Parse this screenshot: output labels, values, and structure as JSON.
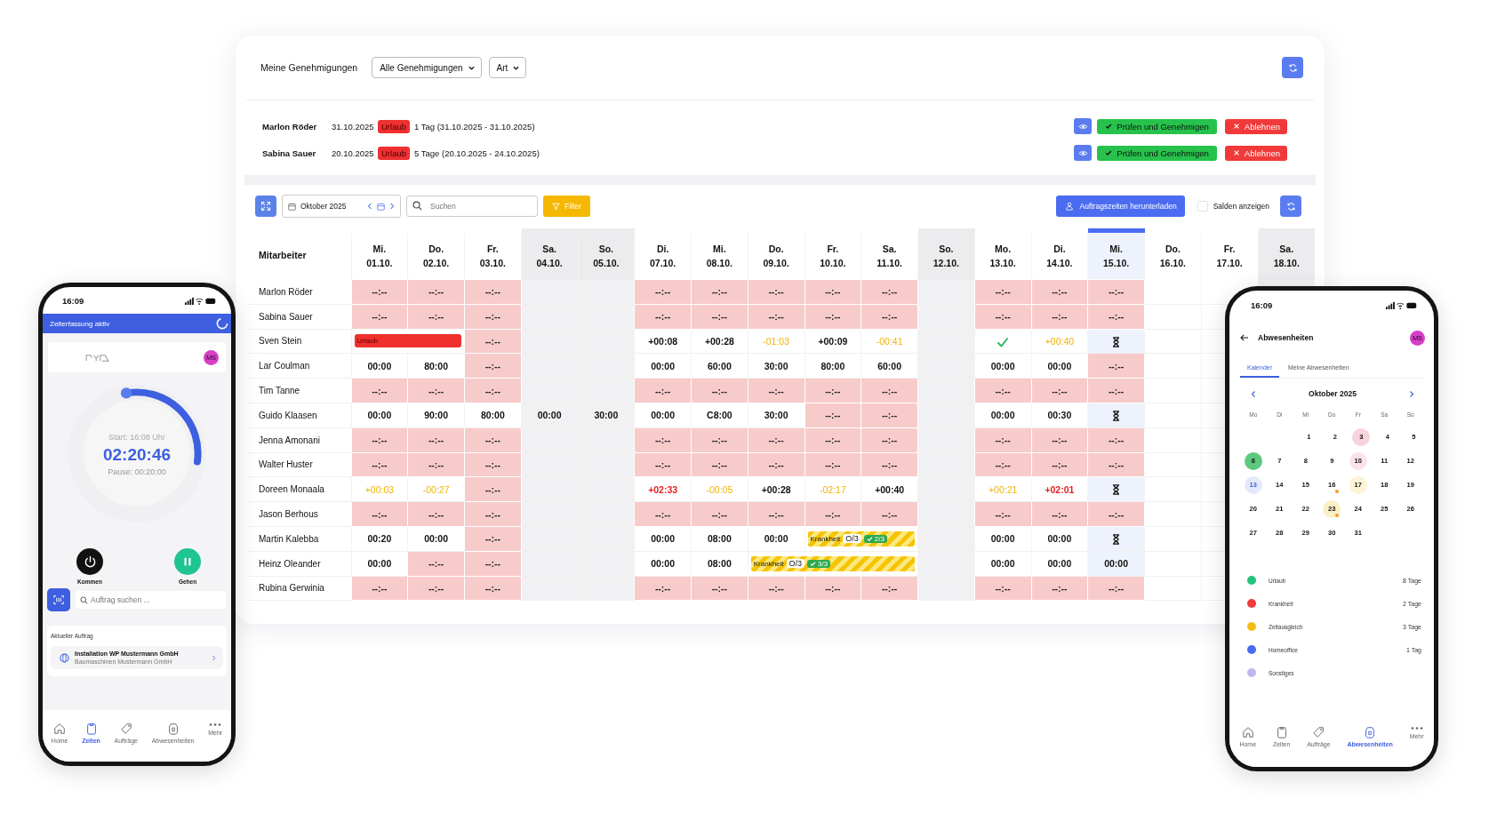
{
  "approvals": {
    "title": "Meine Genehmigungen",
    "filter": "Alle Genehmigungen",
    "type_filter": "Art",
    "requests": [
      {
        "name": "Marlon Röder",
        "date": "31.10.2025",
        "badge": "Urlaub",
        "details": "1 Tag (31.10.2025 - 31.10.2025)",
        "approve": "Prüfen und Genehmigen",
        "reject": "Ablehnen"
      },
      {
        "name": "Sabina Sauer",
        "date": "20.10.2025",
        "badge": "Urlaub",
        "details": "5 Tage (20.10.2025 - 24.10.2025)",
        "approve": "Prüfen und Genehmigen",
        "reject": "Ablehnen"
      }
    ]
  },
  "toolbar": {
    "month": "Oktober 2025",
    "search_placeholder": "Suchen",
    "filter": "Filter",
    "download": "Auftragszeiten herunterladen",
    "balances_label": "Salden anzeigen",
    "balances_checked": false
  },
  "table": {
    "name_header": "Mitarbeiter",
    "columns": [
      {
        "weekday": "Mi.",
        "date": "01.10.",
        "weekend": false,
        "selected": false
      },
      {
        "weekday": "Do.",
        "date": "02.10.",
        "weekend": false,
        "selected": false
      },
      {
        "weekday": "Fr.",
        "date": "03.10.",
        "weekend": false,
        "selected": false
      },
      {
        "weekday": "Sa.",
        "date": "04.10.",
        "weekend": true,
        "selected": false
      },
      {
        "weekday": "So.",
        "date": "05.10.",
        "weekend": true,
        "selected": false
      },
      {
        "weekday": "Di.",
        "date": "07.10.",
        "weekend": false,
        "selected": false
      },
      {
        "weekday": "Mi.",
        "date": "08.10.",
        "weekend": false,
        "selected": false
      },
      {
        "weekday": "Do.",
        "date": "09.10.",
        "weekend": false,
        "selected": false
      },
      {
        "weekday": "Fr.",
        "date": "10.10.",
        "weekend": false,
        "selected": false
      },
      {
        "weekday": "Sa.",
        "date": "11.10.",
        "weekend": false,
        "selected": false
      },
      {
        "weekday": "So.",
        "date": "12.10.",
        "weekend": true,
        "selected": false
      },
      {
        "weekday": "Mo.",
        "date": "13.10.",
        "weekend": false,
        "selected": false
      },
      {
        "weekday": "Di.",
        "date": "14.10.",
        "weekend": false,
        "selected": false
      },
      {
        "weekday": "Mi.",
        "date": "15.10.",
        "weekend": false,
        "selected": true
      },
      {
        "weekday": "Do.",
        "date": "16.10.",
        "weekend": false,
        "selected": false
      },
      {
        "weekday": "Fr.",
        "date": "17.10.",
        "weekend": false,
        "selected": false
      },
      {
        "weekday": "Sa.",
        "date": "18.10.",
        "weekend": true,
        "selected": false
      }
    ],
    "rows": [
      {
        "name": "Marlon Röder",
        "cells": [
          {
            "kind": "missing",
            "text": "--:--"
          },
          {
            "kind": "missing",
            "text": "--:--"
          },
          {
            "kind": "missing",
            "text": "--:--"
          },
          {
            "kind": "empty"
          },
          {
            "kind": "empty"
          },
          {
            "kind": "missing",
            "text": "--:--"
          },
          {
            "kind": "missing",
            "text": "--:--"
          },
          {
            "kind": "missing",
            "text": "--:--"
          },
          {
            "kind": "missing",
            "text": "--:--"
          },
          {
            "kind": "missing",
            "text": "--:--"
          },
          {
            "kind": "empty"
          },
          {
            "kind": "missing",
            "text": "--:--"
          },
          {
            "kind": "missing",
            "text": "--:--"
          },
          {
            "kind": "missing",
            "text": "--:--"
          },
          {
            "kind": "empty"
          },
          {
            "kind": "empty"
          },
          {
            "kind": "empty"
          }
        ]
      },
      {
        "name": "Sabina Sauer",
        "cells": [
          {
            "kind": "missing",
            "text": "--:--"
          },
          {
            "kind": "missing",
            "text": "--:--"
          },
          {
            "kind": "missing",
            "text": "--:--"
          },
          {
            "kind": "empty"
          },
          {
            "kind": "empty"
          },
          {
            "kind": "missing",
            "text": "--:--"
          },
          {
            "kind": "missing",
            "text": "--:--"
          },
          {
            "kind": "missing",
            "text": "--:--"
          },
          {
            "kind": "missing",
            "text": "--:--"
          },
          {
            "kind": "missing",
            "text": "--:--"
          },
          {
            "kind": "empty"
          },
          {
            "kind": "missing",
            "text": "--:--"
          },
          {
            "kind": "missing",
            "text": "--:--"
          },
          {
            "kind": "missing",
            "text": "--:--"
          },
          {
            "kind": "empty"
          },
          {
            "kind": "empty"
          },
          {
            "kind": "empty"
          }
        ]
      },
      {
        "name": "Sven Stein",
        "cells": [
          {
            "kind": "absence",
            "text": "Urlaub",
            "colspan": 2
          },
          {
            "kind": "missing",
            "text": "--:--"
          },
          {
            "kind": "empty"
          },
          {
            "kind": "empty"
          },
          {
            "kind": "value",
            "text": "+00:08"
          },
          {
            "kind": "value",
            "text": "+00:28"
          },
          {
            "kind": "warn",
            "text": "-01:03"
          },
          {
            "kind": "value",
            "text": "+00:09"
          },
          {
            "kind": "warn",
            "text": "-00:41"
          },
          {
            "kind": "empty"
          },
          {
            "kind": "check"
          },
          {
            "kind": "warn",
            "text": "+00:40"
          },
          {
            "kind": "pending"
          },
          {
            "kind": "empty"
          },
          {
            "kind": "empty"
          },
          {
            "kind": "empty"
          }
        ]
      },
      {
        "name": "Lar Coulman",
        "cells": [
          {
            "kind": "value",
            "text": "00:00"
          },
          {
            "kind": "value",
            "text": "80:00"
          },
          {
            "kind": "missing",
            "text": "--:--"
          },
          {
            "kind": "empty"
          },
          {
            "kind": "empty"
          },
          {
            "kind": "value",
            "text": "00:00"
          },
          {
            "kind": "value",
            "text": "60:00"
          },
          {
            "kind": "value",
            "text": "30:00"
          },
          {
            "kind": "value",
            "text": "80:00"
          },
          {
            "kind": "value",
            "text": "60:00"
          },
          {
            "kind": "empty"
          },
          {
            "kind": "value",
            "text": "00:00"
          },
          {
            "kind": "value",
            "text": "00:00"
          },
          {
            "kind": "missing",
            "text": "--:--"
          },
          {
            "kind": "empty"
          },
          {
            "kind": "empty"
          },
          {
            "kind": "empty"
          }
        ]
      },
      {
        "name": "Tim Tanne",
        "cells": [
          {
            "kind": "missing",
            "text": "--:--"
          },
          {
            "kind": "missing",
            "text": "--:--"
          },
          {
            "kind": "missing",
            "text": "--:--"
          },
          {
            "kind": "empty"
          },
          {
            "kind": "empty"
          },
          {
            "kind": "missing",
            "text": "--:--"
          },
          {
            "kind": "missing",
            "text": "--:--"
          },
          {
            "kind": "missing",
            "text": "--:--"
          },
          {
            "kind": "missing",
            "text": "--:--"
          },
          {
            "kind": "missing",
            "text": "--:--"
          },
          {
            "kind": "empty"
          },
          {
            "kind": "missing",
            "text": "--:--"
          },
          {
            "kind": "missing",
            "text": "--:--"
          },
          {
            "kind": "missing",
            "text": "--:--"
          },
          {
            "kind": "empty"
          },
          {
            "kind": "empty"
          },
          {
            "kind": "empty"
          }
        ]
      },
      {
        "name": "Guido Klaasen",
        "cells": [
          {
            "kind": "value",
            "text": "00:00"
          },
          {
            "kind": "value",
            "text": "90:00"
          },
          {
            "kind": "value",
            "text": "80:00"
          },
          {
            "kind": "value",
            "text": "00:00"
          },
          {
            "kind": "value",
            "text": "30:00"
          },
          {
            "kind": "value",
            "text": "00:00"
          },
          {
            "kind": "value",
            "text": "C8:00"
          },
          {
            "kind": "value",
            "text": "30:00"
          },
          {
            "kind": "missing",
            "text": "--:--"
          },
          {
            "kind": "missing",
            "text": "--:--"
          },
          {
            "kind": "empty"
          },
          {
            "kind": "value",
            "text": "00:00"
          },
          {
            "kind": "value",
            "text": "00:30"
          },
          {
            "kind": "pending"
          },
          {
            "kind": "empty"
          },
          {
            "kind": "empty"
          },
          {
            "kind": "empty"
          }
        ]
      },
      {
        "name": "Jenna Amonani",
        "cells": [
          {
            "kind": "missing",
            "text": "--:--"
          },
          {
            "kind": "missing",
            "text": "--:--"
          },
          {
            "kind": "missing",
            "text": "--:--"
          },
          {
            "kind": "empty"
          },
          {
            "kind": "empty"
          },
          {
            "kind": "missing",
            "text": "--:--"
          },
          {
            "kind": "missing",
            "text": "--:--"
          },
          {
            "kind": "missing",
            "text": "--:--"
          },
          {
            "kind": "missing",
            "text": "--:--"
          },
          {
            "kind": "missing",
            "text": "--:--"
          },
          {
            "kind": "empty"
          },
          {
            "kind": "missing",
            "text": "--:--"
          },
          {
            "kind": "missing",
            "text": "--:--"
          },
          {
            "kind": "missing",
            "text": "--:--"
          },
          {
            "kind": "empty"
          },
          {
            "kind": "empty"
          },
          {
            "kind": "empty"
          }
        ]
      },
      {
        "name": "Walter Huster",
        "cells": [
          {
            "kind": "missing",
            "text": "--:--"
          },
          {
            "kind": "missing",
            "text": "--:--"
          },
          {
            "kind": "missing",
            "text": "--:--"
          },
          {
            "kind": "empty"
          },
          {
            "kind": "empty"
          },
          {
            "kind": "missing",
            "text": "--:--"
          },
          {
            "kind": "missing",
            "text": "--:--"
          },
          {
            "kind": "missing",
            "text": "--:--"
          },
          {
            "kind": "missing",
            "text": "--:--"
          },
          {
            "kind": "missing",
            "text": "--:--"
          },
          {
            "kind": "empty"
          },
          {
            "kind": "missing",
            "text": "--:--"
          },
          {
            "kind": "missing",
            "text": "--:--"
          },
          {
            "kind": "missing",
            "text": "--:--"
          },
          {
            "kind": "empty"
          },
          {
            "kind": "empty"
          },
          {
            "kind": "empty"
          }
        ]
      },
      {
        "name": "Doreen Monaala",
        "cells": [
          {
            "kind": "warn",
            "text": "+00:03"
          },
          {
            "kind": "warn",
            "text": "-00:27"
          },
          {
            "kind": "missing",
            "text": "--:--"
          },
          {
            "kind": "empty"
          },
          {
            "kind": "empty"
          },
          {
            "kind": "over",
            "text": "+02:33"
          },
          {
            "kind": "warn",
            "text": "-00:05"
          },
          {
            "kind": "value",
            "text": "+00:28"
          },
          {
            "kind": "warn",
            "text": "-02:17"
          },
          {
            "kind": "value",
            "text": "+00:40"
          },
          {
            "kind": "empty"
          },
          {
            "kind": "warn",
            "text": "+00:21"
          },
          {
            "kind": "over",
            "text": "+02:01"
          },
          {
            "kind": "pending"
          },
          {
            "kind": "empty"
          },
          {
            "kind": "empty"
          },
          {
            "kind": "empty"
          }
        ]
      },
      {
        "name": "Jason Berhous",
        "cells": [
          {
            "kind": "missing",
            "text": "--:--"
          },
          {
            "kind": "missing",
            "text": "--:--"
          },
          {
            "kind": "missing",
            "text": "--:--"
          },
          {
            "kind": "empty"
          },
          {
            "kind": "empty"
          },
          {
            "kind": "missing",
            "text": "--:--"
          },
          {
            "kind": "missing",
            "text": "--:--"
          },
          {
            "kind": "missing",
            "text": "--:--"
          },
          {
            "kind": "missing",
            "text": "--:--"
          },
          {
            "kind": "missing",
            "text": "--:--"
          },
          {
            "kind": "empty"
          },
          {
            "kind": "missing",
            "text": "--:--"
          },
          {
            "kind": "missing",
            "text": "--:--"
          },
          {
            "kind": "missing",
            "text": "--:--"
          },
          {
            "kind": "empty"
          },
          {
            "kind": "empty"
          },
          {
            "kind": "empty"
          }
        ]
      },
      {
        "name": "Martin Kalebba",
        "cells": [
          {
            "kind": "value",
            "text": "00:20"
          },
          {
            "kind": "value",
            "text": "00:00"
          },
          {
            "kind": "missing",
            "text": "--:--"
          },
          {
            "kind": "empty"
          },
          {
            "kind": "empty"
          },
          {
            "kind": "value",
            "text": "00:00"
          },
          {
            "kind": "value",
            "text": "08:00"
          },
          {
            "kind": "value",
            "text": "00:00"
          },
          {
            "kind": "sick",
            "text": "Krankheit",
            "open": "O/3",
            "done": "2/3",
            "colspan": 2
          },
          {
            "kind": "empty"
          },
          {
            "kind": "value",
            "text": "00:00"
          },
          {
            "kind": "value",
            "text": "00:00"
          },
          {
            "kind": "pending"
          },
          {
            "kind": "empty"
          },
          {
            "kind": "empty"
          },
          {
            "kind": "empty"
          }
        ]
      },
      {
        "name": "Heinz Oleander",
        "cells": [
          {
            "kind": "value",
            "text": "00:00"
          },
          {
            "kind": "missing",
            "text": "--:--"
          },
          {
            "kind": "missing",
            "text": "--:--"
          },
          {
            "kind": "empty"
          },
          {
            "kind": "empty"
          },
          {
            "kind": "value",
            "text": "00:00"
          },
          {
            "kind": "value",
            "text": "08:00"
          },
          {
            "kind": "sick",
            "text": "Krankheit",
            "open": "O/3",
            "done": "3/3",
            "colspan": 3
          },
          {
            "kind": "empty"
          },
          {
            "kind": "value",
            "text": "00:00"
          },
          {
            "kind": "value",
            "text": "00:00"
          },
          {
            "kind": "value",
            "text": "00:00"
          },
          {
            "kind": "empty"
          },
          {
            "kind": "empty"
          },
          {
            "kind": "empty"
          }
        ]
      },
      {
        "name": "Rubina Gerwinia",
        "cells": [
          {
            "kind": "missing",
            "text": "--:--"
          },
          {
            "kind": "missing",
            "text": "--:--"
          },
          {
            "kind": "missing",
            "text": "--:--"
          },
          {
            "kind": "empty"
          },
          {
            "kind": "empty"
          },
          {
            "kind": "missing",
            "text": "--:--"
          },
          {
            "kind": "missing",
            "text": "--:--"
          },
          {
            "kind": "missing",
            "text": "--:--"
          },
          {
            "kind": "missing",
            "text": "--:--"
          },
          {
            "kind": "missing",
            "text": "--:--"
          },
          {
            "kind": "empty"
          },
          {
            "kind": "missing",
            "text": "--:--"
          },
          {
            "kind": "missing",
            "text": "--:--"
          },
          {
            "kind": "missing",
            "text": "--:--"
          },
          {
            "kind": "empty"
          },
          {
            "kind": "empty"
          },
          {
            "kind": "empty"
          }
        ]
      }
    ]
  },
  "phone_timer": {
    "time": "16:09",
    "banner": "Zeiterfassung aktiv",
    "avatar": "MS",
    "start": "Start: 16:08 Uhr",
    "elapsed": "02:20:46",
    "pause": "Pause: 00:20:00",
    "clock_in": "Kommen",
    "clock_out": "Gehen",
    "search_placeholder": "Auftrag suchen ...",
    "current_label": "Aktueller Auftrag",
    "current_title": "Installation WP Mustermann GmbH",
    "current_subtitle": "Baumaschinen Mustermann GmbH",
    "nav": [
      {
        "kind": "home",
        "label": "Home",
        "selected": false
      },
      {
        "kind": "times",
        "label": "Zeiten",
        "selected": true
      },
      {
        "kind": "orders",
        "label": "Aufträge",
        "selected": false
      },
      {
        "kind": "absences",
        "label": "Abwesenheiten",
        "selected": false
      },
      {
        "kind": "more",
        "label": "Mehr",
        "selected": false
      }
    ]
  },
  "phone_absences": {
    "time": "16:09",
    "title": "Abwesenheiten",
    "avatar": "MS",
    "tabs": [
      {
        "label": "Kalender",
        "selected": true
      },
      {
        "label": "Meine Abwesenheiten",
        "selected": false
      }
    ],
    "month": "Oktober 2025",
    "weekdays": [
      "Mo",
      "Di",
      "Mi",
      "Do",
      "Fr",
      "Sa",
      "So"
    ],
    "weeks": [
      {
        "right_aligned": true,
        "days": [
          {
            "label": "1"
          },
          {
            "label": "2"
          },
          {
            "label": "3",
            "color": "#f9d3dc"
          },
          {
            "label": "4"
          },
          {
            "label": "5"
          }
        ]
      },
      {
        "right_aligned": false,
        "days": [
          {
            "label": "6",
            "color": "#5dc97e"
          },
          {
            "label": "7"
          },
          {
            "label": "8"
          },
          {
            "label": "9"
          },
          {
            "label": "10",
            "color": "#fbe3e8"
          },
          {
            "label": "11"
          },
          {
            "label": "12"
          }
        ]
      },
      {
        "right_aligned": false,
        "days": [
          {
            "label": "13",
            "today": true
          },
          {
            "label": "14"
          },
          {
            "label": "15"
          },
          {
            "label": "16",
            "dot": true
          },
          {
            "label": "17",
            "color": "#fdf3d6"
          },
          {
            "label": "18"
          },
          {
            "label": "19"
          }
        ]
      },
      {
        "right_aligned": false,
        "days": [
          {
            "label": "20"
          },
          {
            "label": "21"
          },
          {
            "label": "22"
          },
          {
            "label": "23",
            "color": "#fbefc8",
            "dot": true
          },
          {
            "label": "24"
          },
          {
            "label": "25"
          },
          {
            "label": "26"
          }
        ]
      },
      {
        "right_aligned": false,
        "days": [
          {
            "label": "27"
          },
          {
            "label": "28"
          },
          {
            "label": "29"
          },
          {
            "label": "30"
          },
          {
            "label": "31"
          }
        ]
      }
    ],
    "legend": [
      {
        "label": "Urlaub",
        "count": "8 Tage",
        "color": "#22c47a"
      },
      {
        "label": "Krankheit",
        "count": "2 Tage",
        "color": "#ef3b3b"
      },
      {
        "label": "Zeitausgleich",
        "count": "3 Tage",
        "color": "#f6bd16"
      },
      {
        "label": "Homeoffice",
        "count": "1 Tag",
        "color": "#4b6cf0"
      },
      {
        "label": "Sonstiges",
        "color": "#c4b5ec"
      }
    ],
    "nav": [
      {
        "kind": "home",
        "label": "Home",
        "selected": false
      },
      {
        "kind": "times",
        "label": "Zeiten",
        "selected": false
      },
      {
        "kind": "orders",
        "label": "Aufträge",
        "selected": false
      },
      {
        "kind": "absences",
        "label": "Abwesenheiten",
        "selected": true
      },
      {
        "kind": "more",
        "label": "Mehr",
        "selected": false
      }
    ]
  }
}
